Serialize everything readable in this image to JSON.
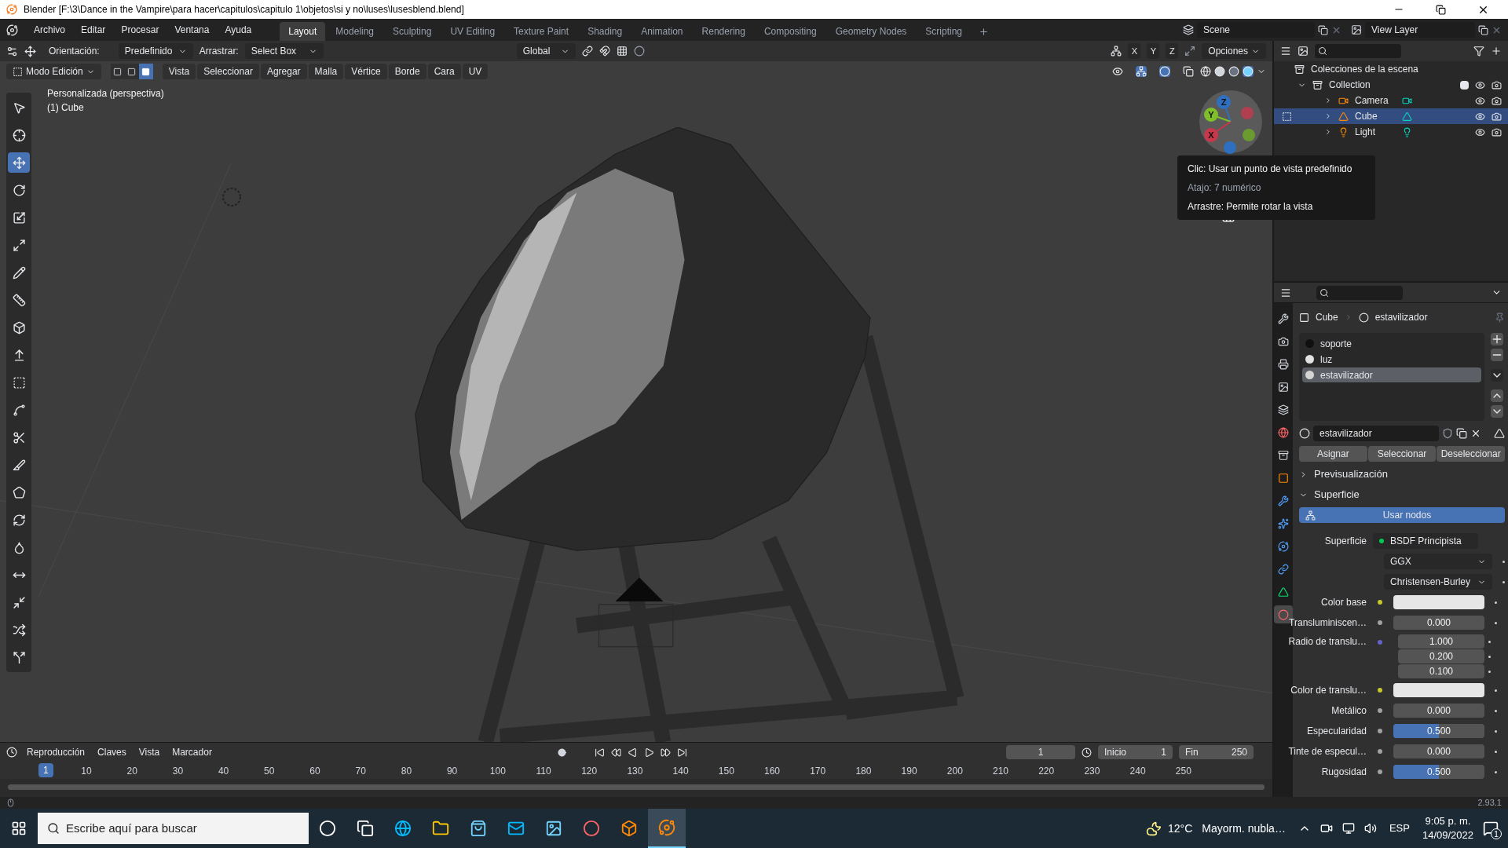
{
  "window": {
    "title": "Blender [F:\\3\\Dance in the Vampire\\para hacer\\capitulos\\capitulo 1\\objetos\\si y no\\luses\\lusesblend.blend]"
  },
  "menu": [
    "Archivo",
    "Editar",
    "Procesar",
    "Ventana",
    "Ayuda"
  ],
  "workspaces": [
    {
      "label": "Layout",
      "selected": true
    },
    {
      "label": "Modeling",
      "selected": false
    },
    {
      "label": "Sculpting",
      "selected": false
    },
    {
      "label": "UV Editing",
      "selected": false
    },
    {
      "label": "Texture Paint",
      "selected": false
    },
    {
      "label": "Shading",
      "selected": false
    },
    {
      "label": "Animation",
      "selected": false
    },
    {
      "label": "Rendering",
      "selected": false
    },
    {
      "label": "Compositing",
      "selected": false
    },
    {
      "label": "Geometry Nodes",
      "selected": false
    },
    {
      "label": "Scripting",
      "selected": false
    }
  ],
  "scene": "Scene",
  "view_layer": "View Layer",
  "tool_header": {
    "orientation_label": "Orientación:",
    "orientation": "Predefinido",
    "drag_label": "Arrastrar:",
    "drag": "Select Box",
    "transform": "Global",
    "axes": [
      "X",
      "Y",
      "Z"
    ],
    "options": "Opciones"
  },
  "edit_header": {
    "mode": "Modo Edición",
    "select_modes": [
      {
        "kind": "vertex",
        "selected": false
      },
      {
        "kind": "edge",
        "selected": false
      },
      {
        "kind": "face",
        "selected": true
      }
    ],
    "menus": [
      "Vista",
      "Seleccionar",
      "Agregar",
      "Malla",
      "Vértice",
      "Borde",
      "Cara",
      "UV"
    ]
  },
  "tools": [
    {
      "kind": "select",
      "selected": false
    },
    {
      "kind": "cursor",
      "selected": false
    },
    {
      "kind": "move",
      "selected": true
    },
    {
      "kind": "rotate",
      "selected": false
    },
    {
      "kind": "scale",
      "selected": false
    },
    {
      "kind": "transform",
      "selected": false
    },
    {
      "kind": "annotate",
      "selected": false
    },
    {
      "kind": "measure",
      "selected": false
    },
    {
      "kind": "add-cube",
      "selected": false
    },
    {
      "kind": "extrude",
      "selected": false
    },
    {
      "kind": "inset",
      "selected": false
    },
    {
      "kind": "bevel",
      "selected": false
    },
    {
      "kind": "loop-cut",
      "selected": false
    },
    {
      "kind": "knife",
      "selected": false
    },
    {
      "kind": "poly-build",
      "selected": false
    },
    {
      "kind": "spin",
      "selected": false
    },
    {
      "kind": "smooth",
      "selected": false
    },
    {
      "kind": "edge-slide",
      "selected": false
    },
    {
      "kind": "shrink",
      "selected": false
    },
    {
      "kind": "shear",
      "selected": false
    },
    {
      "kind": "rip",
      "selected": false
    }
  ],
  "viewport": {
    "view_name": "Personalizada (perspectiva)",
    "object_name": "(1) Cube",
    "gizmo": [
      {
        "label": "Z",
        "color": "#2f6fbf"
      },
      {
        "label": "Y",
        "color": "#7fbf2a"
      },
      {
        "label": "X",
        "color": "#c8374a"
      }
    ],
    "tooltip": [
      "Clic: Usar un punto de vista predefinido",
      "Atajo: 7 numérico",
      "Arrastre: Permite rotar la vista"
    ]
  },
  "outliner": {
    "root": "Colecciones de la escena",
    "collections": [
      {
        "name": "Collection",
        "checked": true,
        "expanded": true,
        "children": [
          {
            "name": "Camera",
            "kind": "camera",
            "selected": false
          },
          {
            "name": "Cube",
            "kind": "mesh",
            "selected": true
          },
          {
            "name": "Light",
            "kind": "light",
            "selected": false
          }
        ]
      }
    ]
  },
  "properties": {
    "tabs": [
      {
        "kind": "tool",
        "selected": false
      },
      {
        "kind": "render",
        "selected": false
      },
      {
        "kind": "output",
        "selected": false
      },
      {
        "kind": "view-layer",
        "selected": false
      },
      {
        "kind": "scene",
        "selected": false
      },
      {
        "kind": "world",
        "selected": false
      },
      {
        "kind": "collection",
        "selected": false
      },
      {
        "kind": "object",
        "selected": false
      },
      {
        "kind": "modifiers",
        "selected": false
      },
      {
        "kind": "particles",
        "selected": false
      },
      {
        "kind": "physics",
        "selected": false
      },
      {
        "kind": "constraints",
        "selected": false
      },
      {
        "kind": "data",
        "selected": false
      },
      {
        "kind": "material",
        "selected": true
      }
    ],
    "breadcrumb": [
      "Cube",
      "estavilizador"
    ],
    "slots": [
      {
        "name": "soporte",
        "color": "#101010",
        "selected": false
      },
      {
        "name": "luz",
        "color": "#e2e2e2",
        "selected": false
      },
      {
        "name": "estavilizador",
        "color": "#d4d4d4",
        "selected": true
      }
    ],
    "material_name": "estavilizador",
    "slot_buttons": [
      "Asignar",
      "Seleccionar",
      "Deseleccionar"
    ],
    "panels": [
      {
        "title": "Previsualización",
        "expanded": false
      },
      {
        "title": "Superficie",
        "expanded": true
      }
    ],
    "use_nodes": "Usar nodos",
    "fields": [
      {
        "kind": "node",
        "label": "Superficie",
        "value": "BSDF Principista"
      },
      {
        "kind": "dropdown",
        "value": "GGX"
      },
      {
        "kind": "dropdown",
        "value": "Christensen-Burley"
      },
      {
        "kind": "color",
        "label": "Color base",
        "color": "#e6e6e6"
      },
      {
        "kind": "slider",
        "label": "Transluminiscen…",
        "value": "0.000",
        "level": 0
      },
      {
        "kind": "vector",
        "label": "Radio de translu…",
        "values": [
          "1.000",
          "0.200",
          "0.100"
        ]
      },
      {
        "kind": "color",
        "label": "Color de translu…",
        "color": "#e6e6e6"
      },
      {
        "kind": "slider",
        "label": "Metálico",
        "value": "0.000",
        "level": 0
      },
      {
        "kind": "slider",
        "label": "Especularidad",
        "value": "0.500",
        "level": 0.5
      },
      {
        "kind": "slider",
        "label": "Tinte de especul…",
        "value": "0.000",
        "level": 0
      },
      {
        "kind": "slider",
        "label": "Rugosidad",
        "value": "0.500",
        "level": 0.5
      }
    ]
  },
  "timeline": {
    "menus": [
      "Reproducción",
      "Claves",
      "Vista",
      "Marcador"
    ],
    "current_frame": "1",
    "start_label": "Inicio",
    "start": "1",
    "end_label": "Fin",
    "end": "250",
    "playhead": "1",
    "ruler": [
      "10",
      "20",
      "30",
      "40",
      "50",
      "60",
      "70",
      "80",
      "90",
      "100",
      "110",
      "120",
      "130",
      "140",
      "150",
      "160",
      "170",
      "180",
      "190",
      "200",
      "210",
      "220",
      "230",
      "240",
      "250"
    ]
  },
  "status_bar": {
    "version": "2.93.1"
  },
  "taskbar": {
    "search_placeholder": "Escribe aquí para buscar",
    "apps": [
      {
        "kind": "cortana",
        "selected": false
      },
      {
        "kind": "task-view",
        "selected": false
      },
      {
        "kind": "browser",
        "selected": false
      },
      {
        "kind": "folder",
        "selected": false
      },
      {
        "kind": "store",
        "selected": false
      },
      {
        "kind": "mail",
        "selected": false
      },
      {
        "kind": "photos",
        "selected": false
      },
      {
        "kind": "chrome",
        "selected": false
      },
      {
        "kind": "app",
        "selected": false
      },
      {
        "kind": "blender",
        "selected": true
      }
    ],
    "temperature": "12°C",
    "weather": "Mayorm. nubla…",
    "language": "ESP",
    "time": "9:05 p. m.",
    "date": "14/09/2022",
    "notifications": "1"
  }
}
